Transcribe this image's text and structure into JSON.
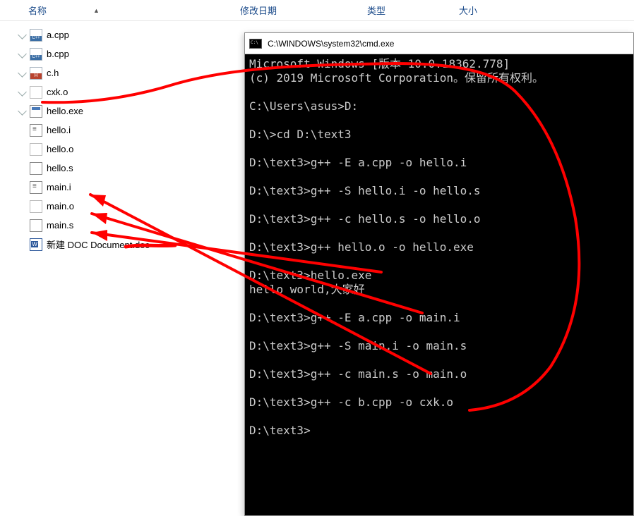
{
  "explorer": {
    "columns": {
      "name": "名称",
      "date": "修改日期",
      "type": "类型",
      "size": "大小"
    },
    "files": [
      {
        "name": "a.cpp",
        "icon": "cpp",
        "pinned": true
      },
      {
        "name": "b.cpp",
        "icon": "cpp",
        "pinned": true
      },
      {
        "name": "c.h",
        "icon": "h",
        "pinned": true
      },
      {
        "name": "cxk.o",
        "icon": "blank",
        "pinned": true
      },
      {
        "name": "hello.exe",
        "icon": "exe",
        "pinned": true
      },
      {
        "name": "hello.i",
        "icon": "i",
        "pinned": false
      },
      {
        "name": "hello.o",
        "icon": "blank",
        "pinned": false
      },
      {
        "name": "hello.s",
        "icon": "s",
        "pinned": false
      },
      {
        "name": "main.i",
        "icon": "i",
        "pinned": false
      },
      {
        "name": "main.o",
        "icon": "blank",
        "pinned": false
      },
      {
        "name": "main.s",
        "icon": "s",
        "pinned": false
      },
      {
        "name": "新建 DOC Document.doc",
        "icon": "doc",
        "pinned": false
      }
    ]
  },
  "cmd": {
    "title": "C:\\WINDOWS\\system32\\cmd.exe",
    "lines": [
      "Microsoft Windows [版本 10.0.18362.778]",
      "(c) 2019 Microsoft Corporation。保留所有权利。",
      "",
      "C:\\Users\\asus>D:",
      "",
      "D:\\>cd D:\\text3",
      "",
      "D:\\text3>g++ -E a.cpp -o hello.i",
      "",
      "D:\\text3>g++ -S hello.i -o hello.s",
      "",
      "D:\\text3>g++ -c hello.s -o hello.o",
      "",
      "D:\\text3>g++ hello.o -o hello.exe",
      "",
      "D:\\text3>hello.exe",
      "hello world,大家好",
      "",
      "D:\\text3>g++ -E a.cpp -o main.i",
      "",
      "D:\\text3>g++ -S main.i -o main.s",
      "",
      "D:\\text3>g++ -c main.s -o main.o",
      "",
      "D:\\text3>g++ -c b.cpp -o cxk.o",
      "",
      "D:\\text3>"
    ]
  },
  "annotation_color": "#ff0000"
}
